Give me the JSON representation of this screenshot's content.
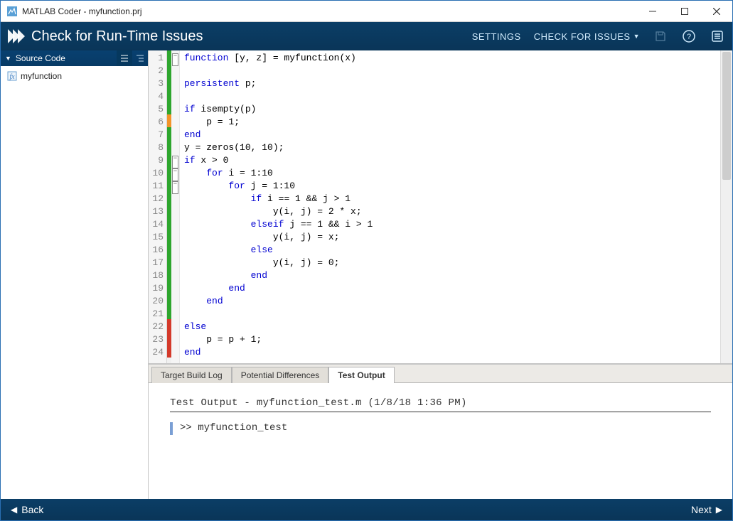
{
  "titlebar": {
    "title": "MATLAB Coder - myfunction.prj"
  },
  "header": {
    "title": "Check for Run-Time Issues",
    "settings": "SETTINGS",
    "check": "CHECK FOR ISSUES"
  },
  "sidebar": {
    "title": "Source Code",
    "items": [
      "myfunction"
    ]
  },
  "editor": {
    "lines": [
      {
        "n": 1,
        "bar": "green",
        "fold": true,
        "tokens": [
          [
            "kw",
            "function"
          ],
          [
            "",
            " [y, z] = myfunction(x)"
          ]
        ]
      },
      {
        "n": 2,
        "bar": "green",
        "tokens": []
      },
      {
        "n": 3,
        "bar": "green",
        "tokens": [
          [
            "kw",
            "persistent"
          ],
          [
            "",
            " p;"
          ]
        ]
      },
      {
        "n": 4,
        "bar": "green",
        "tokens": []
      },
      {
        "n": 5,
        "bar": "green",
        "tokens": [
          [
            "kw",
            "if"
          ],
          [
            "",
            " isempty(p)"
          ]
        ]
      },
      {
        "n": 6,
        "bar": "orange",
        "tokens": [
          [
            "",
            "    p = 1;"
          ]
        ]
      },
      {
        "n": 7,
        "bar": "green",
        "tokens": [
          [
            "kw",
            "end"
          ]
        ]
      },
      {
        "n": 8,
        "bar": "green",
        "tokens": [
          [
            "",
            "y = zeros(10, 10);"
          ]
        ]
      },
      {
        "n": 9,
        "bar": "green",
        "fold": true,
        "tokens": [
          [
            "kw",
            "if"
          ],
          [
            "",
            " x > 0"
          ]
        ]
      },
      {
        "n": 10,
        "bar": "green",
        "fold": true,
        "tokens": [
          [
            "",
            "    "
          ],
          [
            "kw",
            "for"
          ],
          [
            "",
            " i = 1:10"
          ]
        ]
      },
      {
        "n": 11,
        "bar": "green",
        "fold": true,
        "tokens": [
          [
            "",
            "        "
          ],
          [
            "kw",
            "for"
          ],
          [
            "",
            " j = 1:10"
          ]
        ]
      },
      {
        "n": 12,
        "bar": "green",
        "tokens": [
          [
            "",
            "            "
          ],
          [
            "kw",
            "if"
          ],
          [
            "",
            " i == 1 && j > 1"
          ]
        ]
      },
      {
        "n": 13,
        "bar": "green",
        "tokens": [
          [
            "",
            "                y(i, j) = 2 * x;"
          ]
        ]
      },
      {
        "n": 14,
        "bar": "green",
        "tokens": [
          [
            "",
            "            "
          ],
          [
            "kw",
            "elseif"
          ],
          [
            "",
            " j == 1 && i > 1"
          ]
        ]
      },
      {
        "n": 15,
        "bar": "green",
        "tokens": [
          [
            "",
            "                y(i, j) = x;"
          ]
        ]
      },
      {
        "n": 16,
        "bar": "green",
        "tokens": [
          [
            "",
            "            "
          ],
          [
            "kw",
            "else"
          ]
        ]
      },
      {
        "n": 17,
        "bar": "green",
        "tokens": [
          [
            "",
            "                y(i, j) = 0;"
          ]
        ]
      },
      {
        "n": 18,
        "bar": "green",
        "tokens": [
          [
            "",
            "            "
          ],
          [
            "kw",
            "end"
          ]
        ]
      },
      {
        "n": 19,
        "bar": "green",
        "tokens": [
          [
            "",
            "        "
          ],
          [
            "kw",
            "end"
          ]
        ]
      },
      {
        "n": 20,
        "bar": "green",
        "tokens": [
          [
            "",
            "    "
          ],
          [
            "kw",
            "end"
          ]
        ]
      },
      {
        "n": 21,
        "bar": "green",
        "tokens": []
      },
      {
        "n": 22,
        "bar": "red",
        "tokens": [
          [
            "kw",
            "else"
          ]
        ]
      },
      {
        "n": 23,
        "bar": "red",
        "tokens": [
          [
            "",
            "    p = p + 1;"
          ]
        ]
      },
      {
        "n": 24,
        "bar": "red",
        "tokens": [
          [
            "kw",
            "end"
          ]
        ]
      }
    ]
  },
  "bottom": {
    "tabs": [
      "Target Build Log",
      "Potential Differences",
      "Test Output"
    ],
    "active_tab": 2,
    "output_header": "Test Output - myfunction_test.m    (1/8/18 1:36 PM)",
    "output_cmd": ">> myfunction_test"
  },
  "footer": {
    "back": "Back",
    "next": "Next"
  }
}
